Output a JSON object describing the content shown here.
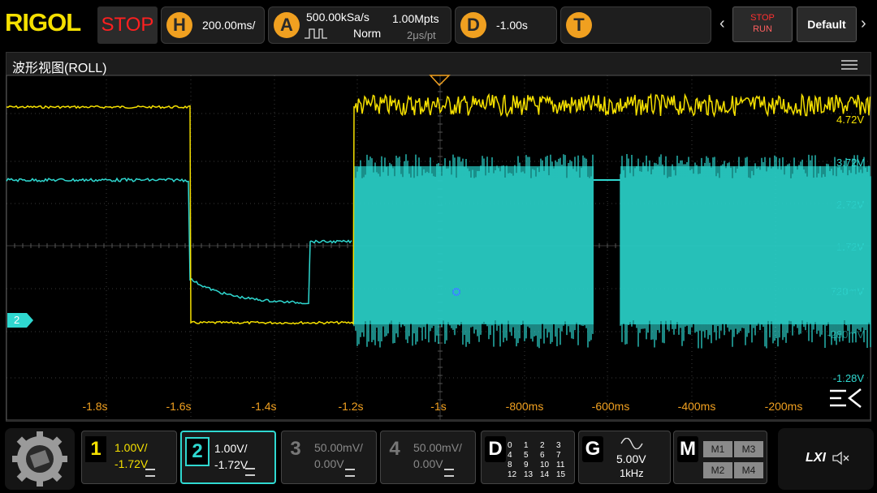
{
  "brand": "RIGOL",
  "run_state": "STOP",
  "timebase": {
    "icon": "H",
    "scale": "200.00ms/"
  },
  "acquire": {
    "icon": "A",
    "sample_rate": "500.00kSa/s",
    "mode": "Norm",
    "memory_depth": "1.00Mpts",
    "time_per_pt": "2μs/pt"
  },
  "delay": {
    "icon": "D",
    "value": "-1.00s"
  },
  "trigger": {
    "icon": "T"
  },
  "controls": {
    "stop_run_top": "STOP",
    "stop_run_bottom": "RUN",
    "default_label": "Default"
  },
  "window": {
    "title": "波形视图(ROLL)"
  },
  "grid": {
    "x_labels": [
      "-1.8s",
      "-1.6s",
      "-1.4s",
      "-1.2s",
      "-1s",
      "-800ms",
      "-600ms",
      "-400ms",
      "-200ms"
    ],
    "cursor_labels": [
      "4.72V",
      "3.72V",
      "2.72V",
      "1.72V",
      "720mV",
      "-280mV",
      "-1.28V"
    ]
  },
  "channel_marker": "2",
  "channels": [
    {
      "num": "1",
      "scale": "1.00V/",
      "offset": "-1.72V",
      "color": "#f5e000",
      "active": false
    },
    {
      "num": "2",
      "scale": "1.00V/",
      "offset": "-1.72V",
      "color": "#2fd8d0",
      "active": true
    },
    {
      "num": "3",
      "scale": "50.00mV/",
      "offset": "0.00V",
      "color": "#777777",
      "active": false
    },
    {
      "num": "4",
      "scale": "50.00mV/",
      "offset": "0.00V",
      "color": "#777777",
      "active": false
    }
  ],
  "digital": {
    "label": "D",
    "rows": [
      [
        "0",
        "1",
        "2",
        "3"
      ],
      [
        "4",
        "5",
        "6",
        "7"
      ],
      [
        "8",
        "9",
        "10",
        "11"
      ],
      [
        "12",
        "13",
        "14",
        "15"
      ]
    ]
  },
  "generator": {
    "label": "G",
    "amplitude": "5.00V",
    "frequency": "1kHz"
  },
  "math": {
    "label": "M",
    "items": [
      "M1",
      "M3",
      "M2",
      "M4"
    ]
  },
  "lxi": "LXI"
}
